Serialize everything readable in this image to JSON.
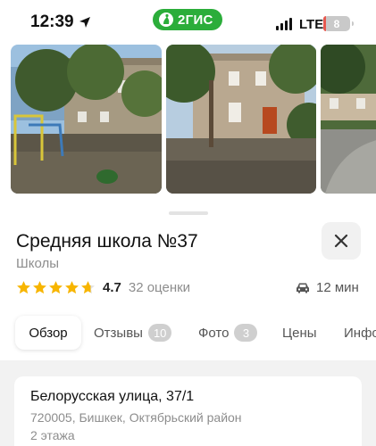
{
  "status_bar": {
    "time": "12:39",
    "network": "LTE",
    "battery": "8",
    "battery_level": 0.08
  },
  "brand": {
    "name": "2ГИС",
    "color": "#2bad3a"
  },
  "gallery": {
    "photo_count_visible": 3
  },
  "place": {
    "title": "Средняя школа №37",
    "category": "Школы",
    "rating": "4.7",
    "rating_stars": 4.7,
    "reviews_count": "32 оценки",
    "travel_time": "12 мин",
    "travel_icon": "car-icon"
  },
  "tabs": [
    {
      "label": "Обзор",
      "badge": "",
      "active": true
    },
    {
      "label": "Отзывы",
      "badge": "10",
      "active": false
    },
    {
      "label": "Фото",
      "badge": "3",
      "active": false
    },
    {
      "label": "Цены",
      "badge": "",
      "active": false
    },
    {
      "label": "Инфо",
      "badge": "",
      "active": false
    }
  ],
  "address": {
    "street": "Белорусская улица, 37/1",
    "city": "720005, Бишкек, Октябрьский район",
    "floors": "2 этажа"
  },
  "colors": {
    "star": "#f7b500",
    "accent": "#2bad3a",
    "battery_low": "#e7584f"
  }
}
